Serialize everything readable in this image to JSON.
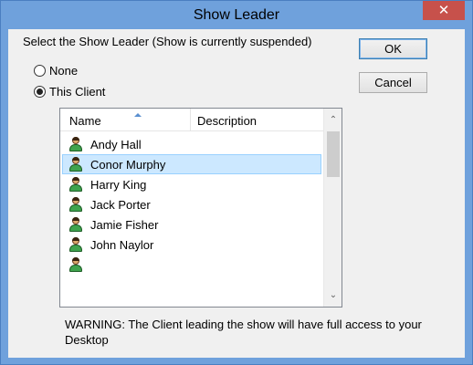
{
  "window": {
    "title": "Show Leader",
    "close_glyph": "✕"
  },
  "prompt": "Select the Show Leader (Show is currently suspended)",
  "buttons": {
    "ok": "OK",
    "cancel": "Cancel"
  },
  "radios": [
    {
      "label": "None",
      "checked": false
    },
    {
      "label": "This Client",
      "checked": true
    }
  ],
  "list": {
    "columns": [
      "Name",
      "Description"
    ],
    "sort_icon": "sort-ascending-icon",
    "rows": [
      {
        "name": "Andy Hall",
        "description": "",
        "selected": false
      },
      {
        "name": "Conor Murphy",
        "description": "",
        "selected": true
      },
      {
        "name": "Harry King",
        "description": "",
        "selected": false
      },
      {
        "name": "Jack Porter",
        "description": "",
        "selected": false
      },
      {
        "name": "Jamie Fisher",
        "description": "",
        "selected": false
      },
      {
        "name": "John Naylor",
        "description": "",
        "selected": false
      }
    ],
    "row_icon": "user-icon"
  },
  "scrollbar": {
    "up_glyph": "⌃",
    "down_glyph": "⌄"
  },
  "warning": "WARNING: The Client leading the show will have full access to your Desktop",
  "colors": {
    "titlebar": "#6fa1dc",
    "close": "#c7514b",
    "selection": "#cce8ff"
  }
}
